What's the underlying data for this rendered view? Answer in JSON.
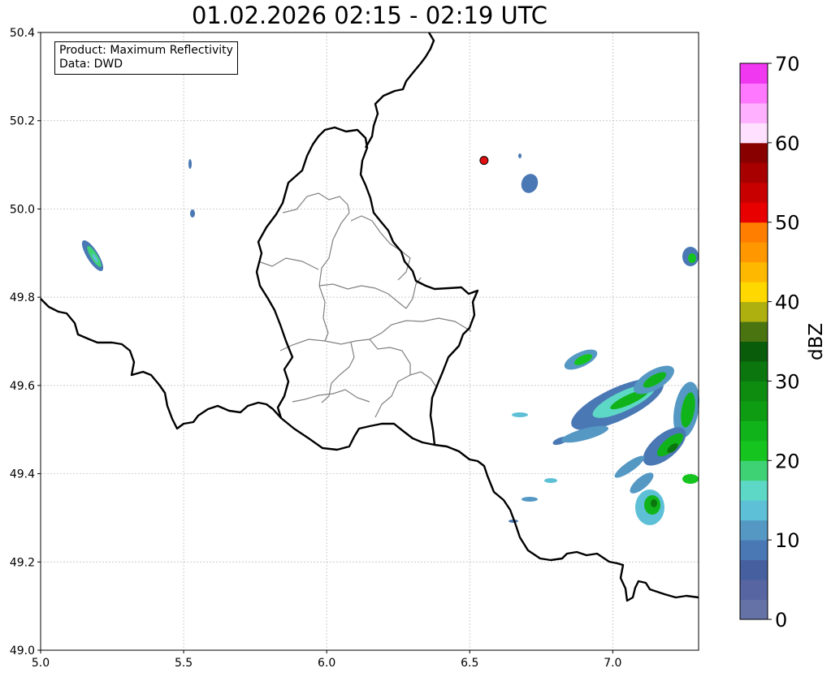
{
  "title": "01.02.2026 02:15 - 02:19 UTC",
  "info_box": {
    "line1": "Product: Maximum Reflectivity",
    "line2": "Data: DWD"
  },
  "axes": {
    "xlim": [
      5.0,
      7.3
    ],
    "ylim": [
      49.0,
      50.4
    ],
    "xticks": [
      "5.0",
      "5.5",
      "6.0",
      "6.5",
      "7.0"
    ],
    "xtick_values": [
      5.0,
      5.5,
      6.0,
      6.5,
      7.0
    ],
    "yticks": [
      "49.0",
      "49.2",
      "49.4",
      "49.6",
      "49.8",
      "50.0",
      "50.2",
      "50.4"
    ],
    "ytick_values": [
      49.0,
      49.2,
      49.4,
      49.6,
      49.8,
      50.0,
      50.2,
      50.4
    ],
    "grid": true
  },
  "colorbar": {
    "label": "dBZ",
    "ticks": [
      "0",
      "10",
      "20",
      "30",
      "40",
      "50",
      "60",
      "70"
    ],
    "tick_values": [
      0,
      10,
      20,
      30,
      40,
      50,
      60,
      70
    ],
    "range": [
      0,
      70
    ],
    "step": 2.5,
    "colors": [
      "#6472a6",
      "#5766a2",
      "#46609f",
      "#4a78b4",
      "#5598c4",
      "#5ec0d6",
      "#5ed8c6",
      "#3ed275",
      "#15c41e",
      "#10b41a",
      "#0e9c13",
      "#0d8c10",
      "#0b760e",
      "#095c0a",
      "#4a7410",
      "#aeb010",
      "#ffd800",
      "#ffb800",
      "#ff9800",
      "#ff7e00",
      "#e80000",
      "#c80000",
      "#a80000",
      "#880000",
      "#ffe0ff",
      "#ffb0ff",
      "#ff78ff",
      "#f038f0"
    ]
  },
  "marker": {
    "lon": 6.55,
    "lat": 50.11,
    "color": "#e01010"
  }
}
